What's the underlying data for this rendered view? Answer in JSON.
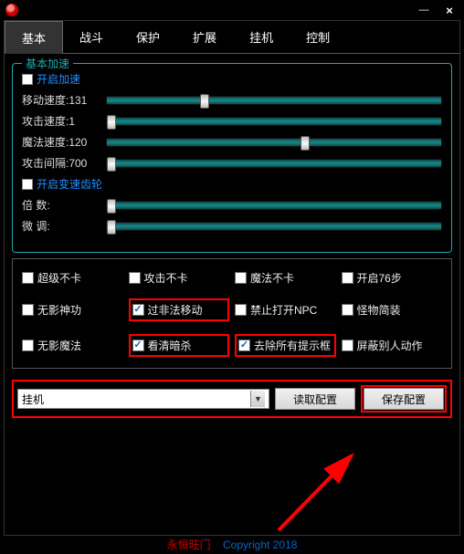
{
  "titlebar": {
    "minimize": "—",
    "close": "×"
  },
  "tabs": [
    "基本",
    "战斗",
    "保护",
    "扩展",
    "挂机",
    "控制"
  ],
  "speed": {
    "legend": "基本加速",
    "enable_speed": "开启加速",
    "enable_gear": "开启变速齿轮",
    "sliders": [
      {
        "label": "移动速度:131",
        "pos": 28
      },
      {
        "label": "攻击速度:1",
        "pos": 0
      },
      {
        "label": "魔法速度:120",
        "pos": 58
      },
      {
        "label": "攻击间隔:700",
        "pos": 0
      }
    ],
    "gear_sliders": [
      {
        "label": "倍    数:",
        "pos": 0
      },
      {
        "label": "微    调:",
        "pos": 0
      }
    ]
  },
  "grid": [
    {
      "label": "超级不卡",
      "checked": false
    },
    {
      "label": "攻击不卡",
      "checked": false
    },
    {
      "label": "魔法不卡",
      "checked": false
    },
    {
      "label": "开启76步",
      "checked": false
    },
    {
      "label": "无影神功",
      "checked": false
    },
    {
      "label": "过非法移动",
      "checked": true,
      "hl": true
    },
    {
      "label": "禁止打开NPC",
      "checked": false
    },
    {
      "label": "怪物简装",
      "checked": false
    },
    {
      "label": "无影魔法",
      "checked": false
    },
    {
      "label": "看清暗杀",
      "checked": true,
      "hl": true
    },
    {
      "label": "去除所有提示框",
      "checked": true,
      "hl": true
    },
    {
      "label": "屏蔽别人动作",
      "checked": false
    }
  ],
  "bottom": {
    "combo_value": "挂机",
    "read_btn": "读取配置",
    "save_btn": "保存配置"
  },
  "footer": {
    "brand": "永恒旺门",
    "copyright": "Copyright 2018"
  }
}
